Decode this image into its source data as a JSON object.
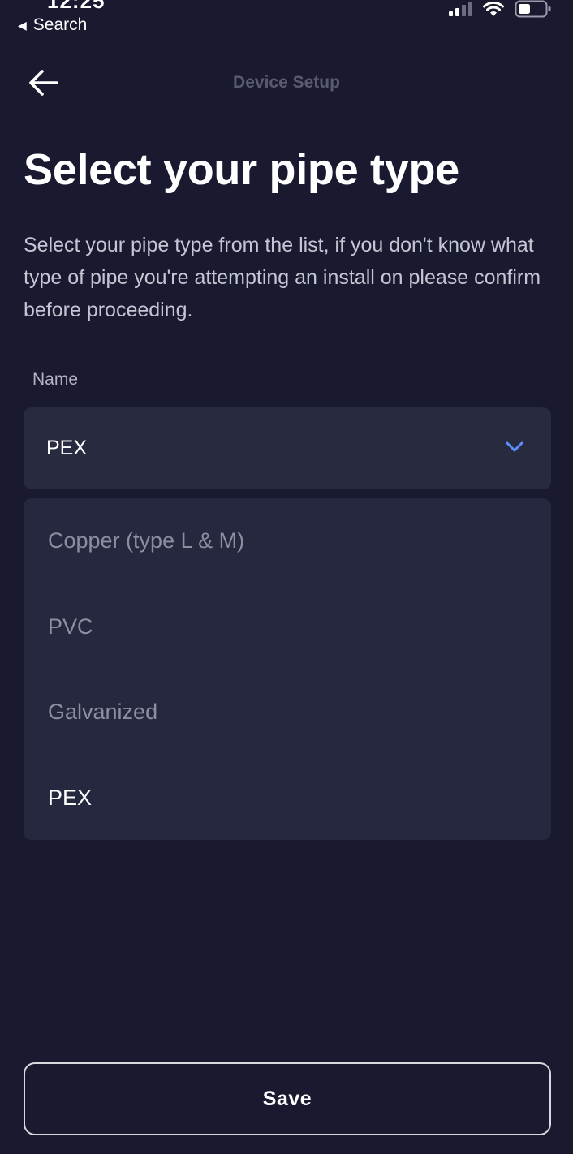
{
  "status_bar": {
    "time": "12:25",
    "back_label": "Search"
  },
  "header": {
    "title": "Device Setup"
  },
  "page": {
    "title": "Select your pipe type",
    "description": "Select your pipe type from the list, if you don't know what type of pipe you're attempting an install on please confirm before proceeding."
  },
  "field": {
    "label": "Name",
    "selected_value": "PEX"
  },
  "dropdown": {
    "options": [
      {
        "label": "Copper (type L & M)",
        "selected": false
      },
      {
        "label": "PVC",
        "selected": false
      },
      {
        "label": "Galvanized",
        "selected": false
      },
      {
        "label": "PEX",
        "selected": true
      }
    ]
  },
  "actions": {
    "save_label": "Save"
  },
  "colors": {
    "background": "#191a30",
    "surface": "#282a40",
    "accent": "#5b8ff9",
    "muted_text": "#8d8ea0"
  }
}
